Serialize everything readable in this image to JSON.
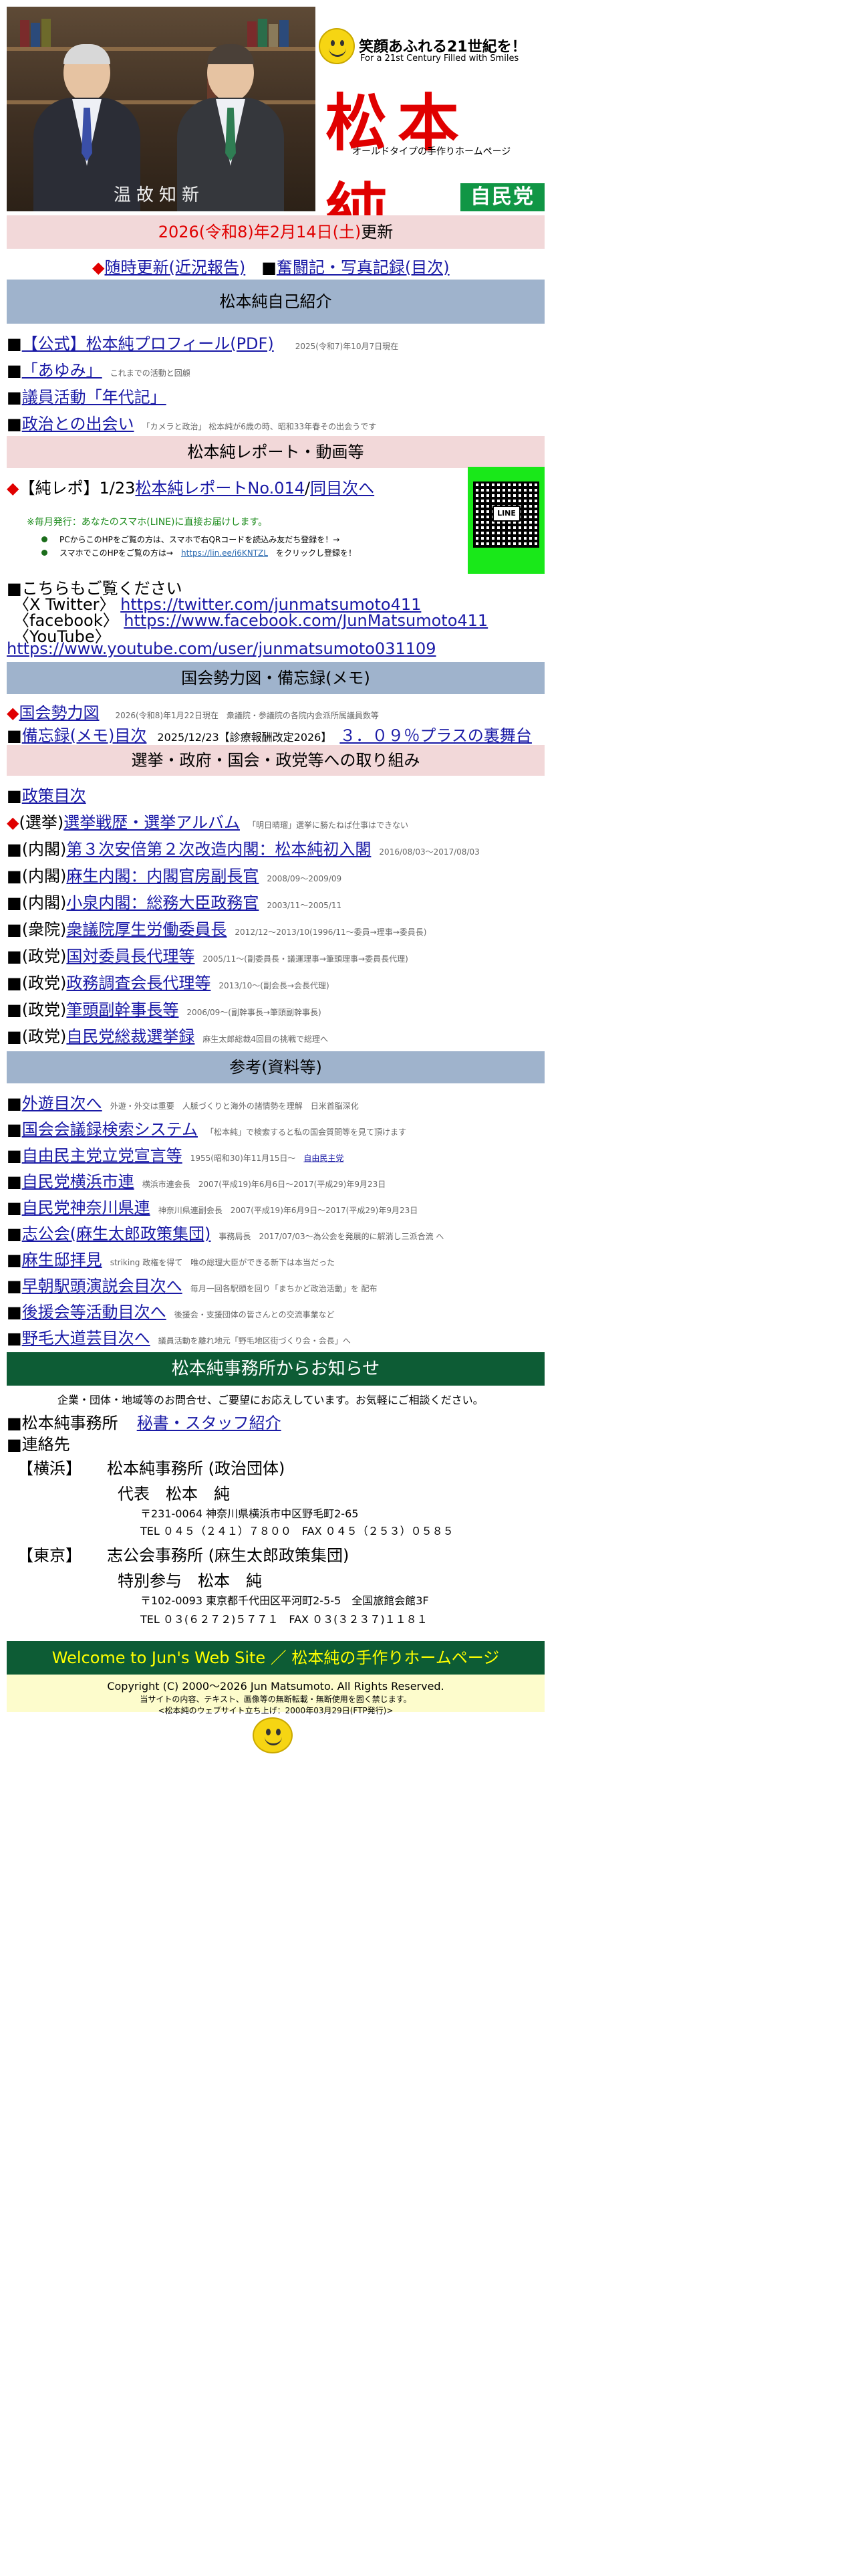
{
  "header": {
    "tagline_jp": "笑顔あふれる21世紀を！",
    "tagline_en": "For a 21st Century Filled with Smiles",
    "name": "松本 純",
    "subtag": "オールドタイプの手作りホームページ",
    "party": "自民党",
    "calligraphy": "温故知新"
  },
  "date_bar": {
    "date": "2026(令和8)年2月14日(土)",
    "suffix": "更新"
  },
  "nav": {
    "diamond": "◆",
    "link1": "随時更新(近況報告)",
    "square": "■",
    "link2": "奮闘記・写真記録(目次)"
  },
  "sections": {
    "intro": "松本純自己紹介",
    "report": "松本純レポート・動画等",
    "kokkai": "国会勢力図・備忘録(メモ)",
    "election": "選挙・政府・国会・政党等への取り組み",
    "ref": "参考(資料等)",
    "office": "松本純事務所からお知らせ"
  },
  "intro_items": [
    {
      "link": "【公式】松本純プロフィール(PDF)",
      "note": "2025(令和7)年10月7日現在"
    },
    {
      "link": "「あゆみ」",
      "note": "これまでの活動と回顧"
    },
    {
      "link": "議員活動「年代記」",
      "note": ""
    },
    {
      "link": "政治との出会い",
      "note": "「カメラと政治」 松本純が6歳の時、昭和33年春その出会うです"
    }
  ],
  "report": {
    "prefix": "【純レポ】1/23",
    "link1": "松本純レポートNo.014",
    "slash": "/",
    "link2": "同目次へ",
    "notice": "※毎月発行：あなたのスマホ(LINE)に直接お届けします。",
    "bullet1": "PCからこのHPをご覧の方は、スマホで右QRコードを読込み友だち登録を！→",
    "bullet2_pre": "スマホでこのHPをご覧の方は→",
    "bullet2_link": "https://lin.ee/i6KNTZL",
    "bullet2_post": "をクリックし登録を！",
    "qr_label": "LINE"
  },
  "social": {
    "heading": "■こちらもご覧ください",
    "x_label": "〈X Twitter〉",
    "x_url": "https://twitter.com/junmatsumoto411",
    "fb_label": "〈facebook〉",
    "fb_url": "https://www.facebook.com/JunMatsumoto411",
    "yt_label": "〈YouTube〉",
    "yt_url": "https://www.youtube.com/user/junmatsumoto031109"
  },
  "kokkai_items": [
    {
      "mark": "◆",
      "link": "国会勢力図",
      "note": "2026(令和8)年1月22日現在",
      "note2": "衆議院・参議院の各院内会派所属議員数等"
    },
    {
      "mark": "■",
      "link": "備忘録(メモ)目次",
      "note": "2025/12/23【診療報酬改定2026】",
      "link2": "３．０９％プラスの裏舞台"
    }
  ],
  "policy": [
    {
      "mark": "■",
      "pre": "",
      "link": "政策目次",
      "note": ""
    },
    {
      "mark": "◆",
      "pre": "(選挙)",
      "link": "選挙戦歴・選挙アルバム",
      "note": "「明日晴瑠」選挙に勝たねば仕事はできない"
    },
    {
      "mark": "■",
      "pre": "(内閣)",
      "link": "第３次安倍第２次改造内閣：松本純初入閣",
      "note": "2016/08/03〜2017/08/03"
    },
    {
      "mark": "■",
      "pre": "(内閣)",
      "link": "麻生内閣：内閣官房副長官",
      "note": "2008/09〜2009/09"
    },
    {
      "mark": "■",
      "pre": "(内閣)",
      "link": "小泉内閣：総務大臣政務官",
      "note": "2003/11〜2005/11"
    },
    {
      "mark": "■",
      "pre": "(衆院)",
      "link": "衆議院厚生労働委員長",
      "note": "2012/12〜2013/10(1996/11〜委員→理事→委員長)"
    },
    {
      "mark": "■",
      "pre": "(政党)",
      "link": "国対委員長代理等",
      "note": "2005/11〜(副委員長・議運理事→筆頭理事→委員長代理)"
    },
    {
      "mark": "■",
      "pre": "(政党)",
      "link": "政務調査会長代理等",
      "note": "2013/10〜(副会長→会長代理)"
    },
    {
      "mark": "■",
      "pre": "(政党)",
      "link": "筆頭副幹事長等",
      "note": "2006/09〜(副幹事長→筆頭副幹事長)"
    },
    {
      "mark": "■",
      "pre": "(政党)",
      "link": "自民党総裁選挙録",
      "note": "麻生太郎総裁4回目の挑戦で総理へ"
    }
  ],
  "ref_items": [
    {
      "link": "外遊目次へ",
      "note": "外遊・外交は重要　人脈づくりと海外の諸情勢を理解　日米首脳深化",
      "extra": ""
    },
    {
      "link": "国会会議録検索システム",
      "note": "「松本純」で検索すると私の国会質問等を見て頂けます",
      "extra": ""
    },
    {
      "link": "自由民主党立党宣言等",
      "note": "1955(昭和30)年11月15日〜",
      "extra": "自由民主党"
    },
    {
      "link": "自民党横浜市連",
      "note": "横浜市連会長",
      "extra": "2007(平成19)年6月6日〜2017(平成29)年9月23日"
    },
    {
      "link": "自民党神奈川県連",
      "note": "神奈川県連副会長",
      "extra": "2007(平成19)年6月9日〜2017(平成29)年9月23日"
    },
    {
      "link": "志公会(麻生太郎政策集団)",
      "note": "事務局長",
      "extra": "2017/07/03〜為公会を発展的に解消し三派合流 へ"
    },
    {
      "link": "麻生邸拝見",
      "note": "striking 政権を得て　唯の総理大臣ができる新下は本当だった",
      "extra": ""
    },
    {
      "link": "早朝駅頭演説会目次へ",
      "note": "毎月一回各駅頭を回り「まちかど政治活動」を 配布",
      "extra": ""
    },
    {
      "link": "後援会等活動目次へ",
      "note": "後援会・支援団体の皆さんとの交流事業など",
      "extra": ""
    },
    {
      "link": "野毛大道芸目次へ",
      "note": "議員活動を離れ地元「野毛地区街づくり会・会長」へ",
      "extra": ""
    }
  ],
  "office": {
    "intro": "企業・団体・地域等のお問合せ、ご要望にお応えしています。お気軽にご相談ください。",
    "office_label": "■松本純事務所",
    "staff_link": "秘書・スタッフ紹介",
    "contact_label": "■連絡先",
    "yokohama_label": "【横浜】",
    "yokohama_name": "松本純事務所 (政治団体)",
    "yokohama_rep": "代表　松本　純",
    "yokohama_addr": "〒231-0064 神奈川県横浜市中区野毛町2-65",
    "yokohama_tel": "TEL ０４５（２４１）７８００　FAX ０４５（２５３）０５８５",
    "tokyo_label": "【東京】",
    "tokyo_name": "志公会事務所 (麻生太郎政策集団)",
    "tokyo_rep": "特別参与　松本　純",
    "tokyo_addr": "〒102-0093 東京都千代田区平河町2-5-5　全国旅館会館3F",
    "tokyo_tel": "TEL ０３(６２７２)５７７１　FAX ０３(３２３７)１１８１"
  },
  "footer": {
    "welcome": "Welcome to Jun's Web Site ／ 松本純の手作りホームページ",
    "copyright": "Copyright (C) 2000〜2026 Jun Matsumoto. All Rights Reserved.",
    "notice": "当サイトの内容、テキスト、画像等の無断転載・無断使用を固く禁じます。",
    "since": "<松本純のウェブサイト立ち上げ：2000年03月29日(FTP発行)>"
  }
}
